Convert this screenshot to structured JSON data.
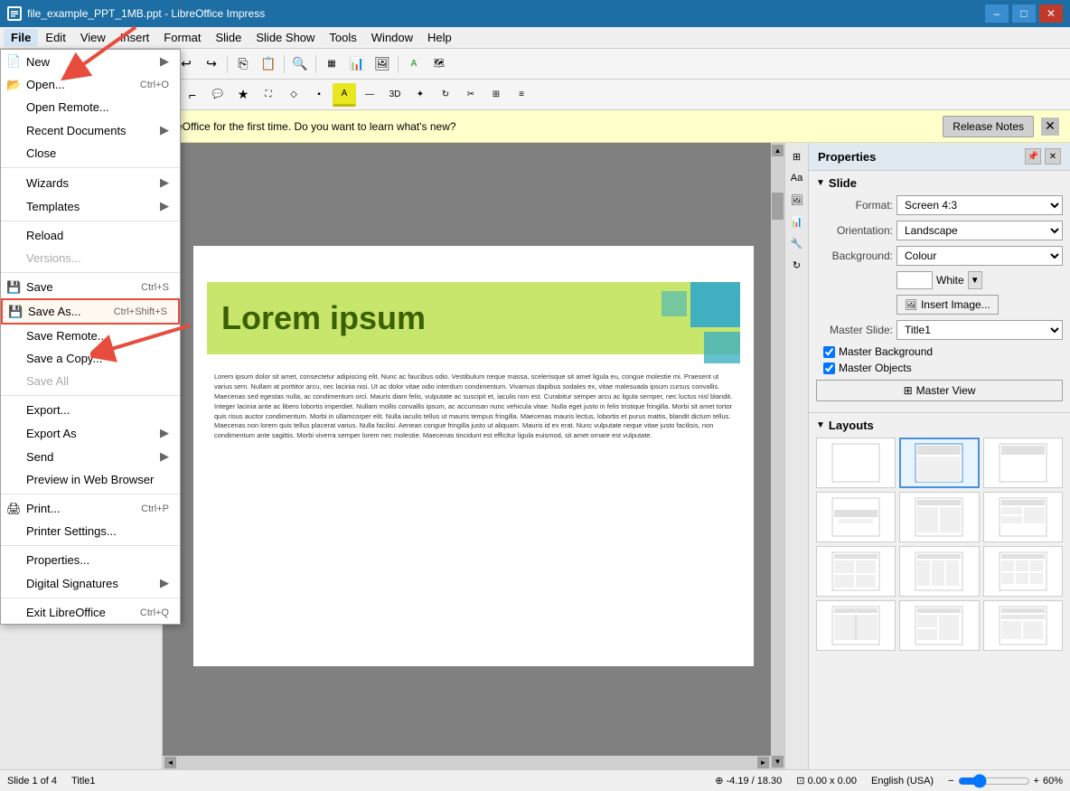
{
  "titleBar": {
    "title": "file_example_PPT_1MB.ppt - LibreOffice Impress",
    "minimize": "–",
    "maximize": "□",
    "close": "✕"
  },
  "menuBar": {
    "items": [
      "File",
      "Edit",
      "View",
      "Insert",
      "Format",
      "Slide",
      "Slide Show",
      "Tools",
      "Window",
      "Help"
    ]
  },
  "infoBar": {
    "message": "You are running version 6.4 of LibreOffice for the first time. Do you want to learn what's new?",
    "releaseNotes": "Release Notes",
    "close": "✕"
  },
  "fileMenu": {
    "items": [
      {
        "label": "New",
        "shortcut": "",
        "arrow": "▶",
        "icon": ""
      },
      {
        "label": "Open...",
        "shortcut": "Ctrl+O",
        "arrow": "",
        "icon": ""
      },
      {
        "label": "Open Remote...",
        "shortcut": "",
        "arrow": "",
        "icon": ""
      },
      {
        "label": "Recent Documents",
        "shortcut": "",
        "arrow": "▶",
        "icon": ""
      },
      {
        "label": "Close",
        "shortcut": "",
        "arrow": "",
        "icon": ""
      },
      {
        "sep": true
      },
      {
        "label": "Wizards",
        "shortcut": "",
        "arrow": "▶",
        "icon": ""
      },
      {
        "label": "Templates",
        "shortcut": "",
        "arrow": "▶",
        "icon": ""
      },
      {
        "sep": true
      },
      {
        "label": "Reload",
        "shortcut": "",
        "arrow": "",
        "icon": ""
      },
      {
        "label": "Versions...",
        "shortcut": "",
        "arrow": "",
        "disabled": true,
        "icon": ""
      },
      {
        "sep": true
      },
      {
        "label": "Save",
        "shortcut": "Ctrl+S",
        "arrow": "",
        "icon": "💾"
      },
      {
        "label": "Save As...",
        "shortcut": "Ctrl+Shift+S",
        "arrow": "",
        "icon": "💾",
        "highlighted": true
      },
      {
        "label": "Save Remote...",
        "shortcut": "",
        "arrow": "",
        "icon": ""
      },
      {
        "label": "Save a Copy...",
        "shortcut": "",
        "arrow": "",
        "icon": ""
      },
      {
        "label": "Save All",
        "shortcut": "",
        "arrow": "",
        "disabled": true,
        "icon": ""
      },
      {
        "sep": true
      },
      {
        "label": "Export...",
        "shortcut": "",
        "arrow": "",
        "icon": ""
      },
      {
        "label": "Export As",
        "shortcut": "",
        "arrow": "▶",
        "icon": ""
      },
      {
        "label": "Send",
        "shortcut": "",
        "arrow": "▶",
        "icon": ""
      },
      {
        "label": "Preview in Web Browser",
        "shortcut": "",
        "arrow": "",
        "icon": ""
      },
      {
        "sep": true
      },
      {
        "label": "Print...",
        "shortcut": "Ctrl+P",
        "arrow": "",
        "icon": "🖨"
      },
      {
        "label": "Printer Settings...",
        "shortcut": "",
        "arrow": "",
        "icon": ""
      },
      {
        "sep": true
      },
      {
        "label": "Properties...",
        "shortcut": "",
        "arrow": "",
        "icon": ""
      },
      {
        "label": "Digital Signatures",
        "shortcut": "",
        "arrow": "▶",
        "icon": ""
      },
      {
        "sep": true
      },
      {
        "label": "Exit LibreOffice",
        "shortcut": "Ctrl+Q",
        "arrow": "",
        "icon": ""
      }
    ]
  },
  "properties": {
    "title": "Properties",
    "slideSection": "Slide",
    "formatLabel": "Format:",
    "formatValue": "Screen 4:3",
    "orientationLabel": "Orientation:",
    "orientationValue": "Landscape",
    "backgroundLabel": "Background:",
    "backgroundValue": "Colour",
    "colorLabel": "White",
    "insertImageBtn": "Insert Image...",
    "masterSlideLabel": "Master Slide:",
    "masterSlideValue": "Title1",
    "masterBackground": "Master Background",
    "masterObjects": "Master Objects",
    "masterViewBtn": "Master View",
    "layoutsSection": "Layouts"
  },
  "status": {
    "slide": "Slide 1 of 4",
    "layout": "Title1",
    "coords": "-4.19 / 18.30",
    "size": "0.00 x 0.00",
    "locale": "English (USA)",
    "zoom": "60%"
  },
  "slide": {
    "title": "Lorem ipsum",
    "bodyText": "Lorem ipsum dolor sit amet, consectetur adipiscing elit. Nunc ac faucibus odio. Vestibulum neque massa, scelerisque sit amet ligula eu, congue molestie mi. Praesent ut varius sem. Nullam at porttitor arcu, nec lacinia nisi. Ut ac dolor vitae odio interdum condimentum. Vivamus dapibus sodales ex, vitae malesuada ipsum cursus convallis. Maecenas sed egestas nulla, ac condimentum orci. Mauris diam felis, vulputate ac suscipit et, iaculis non est. Curabitur semper arcu ac ligula semper, nec luctus nisl blandit. Integer lacinia ante ac libero lobortis imperdiet. Nullam mollis convallis ipsum, ac accumsan nunc vehicula vitae. Nulla eget justo in felis tristique fringilla. Morbi sit amet tortor quis risus auctor condimentum. Morbi in ullamcorper elit. Nulla iaculis tellus ut mauris tempus fringilla.\n\nMaecenas mauris lectus, lobortis et purus mattis, blandit dictum tellus. Maecenas non lorem quis tellus placerat varius. Nulla facilisi. Aenean congue fringilla justo ut aliquam. Mauris id ex erat. Nunc vulputate neque vitae justo facilisis, non condimentum ante sagittis. Morbi viverra semper lorem nec molestie. Maecenas tincidunt est efficitur ligula euismod, sit amet ornare est vulputate."
  }
}
